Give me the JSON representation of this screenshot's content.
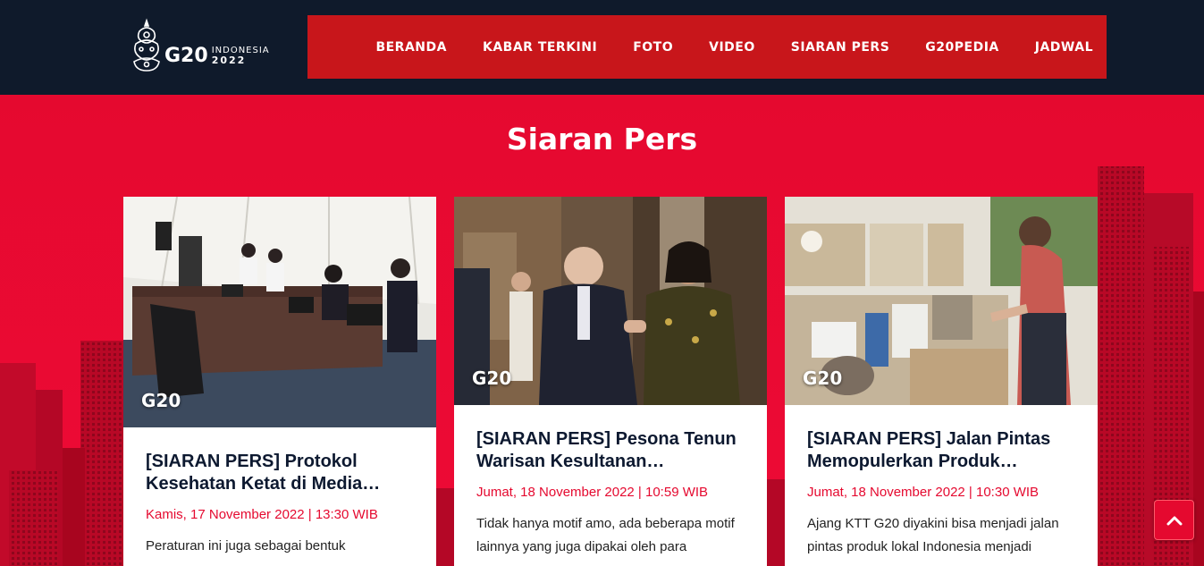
{
  "header": {
    "logo_alt": "G20 INDONESIA 2022",
    "logo_g20": "G20",
    "logo_country": "INDONESIA",
    "logo_year": "2022",
    "nav": [
      "BERANDA",
      "KABAR TERKINI",
      "FOTO",
      "VIDEO",
      "SIARAN PERS",
      "G20PEDIA",
      "JADWAL"
    ]
  },
  "section": {
    "title": "Siaran Pers"
  },
  "cards": [
    {
      "badge": "G20",
      "title": "[SIARAN PERS] Protokol Kesehatan Ketat di Media…",
      "date": "Kamis, 17 November 2022 | 13:30 WIB",
      "excerpt": "Peraturan ini juga sebagai bentuk"
    },
    {
      "badge": "G20",
      "title": "[SIARAN PERS] Pesona Tenun Warisan Kesultanan…",
      "date": "Jumat, 18 November 2022 | 10:59 WIB",
      "excerpt": "Tidak hanya motif amo, ada beberapa motif lainnya yang juga dipakai oleh para"
    },
    {
      "badge": "G20",
      "title": "[SIARAN PERS] Jalan Pintas Memopulerkan Produk…",
      "date": "Jumat, 18 November 2022 | 10:30 WIB",
      "excerpt": "Ajang KTT G20 diyakini bisa menjadi jalan pintas produk lokal Indonesia menjadi"
    }
  ],
  "colors": {
    "brand_red": "#e5092f",
    "nav_red": "#c8161b",
    "header_navy": "#0f1a2b",
    "title_navy": "#0d1930"
  },
  "icons": {
    "scroll_top": "chevron-up-icon",
    "logo": "g20-emblem-icon"
  }
}
